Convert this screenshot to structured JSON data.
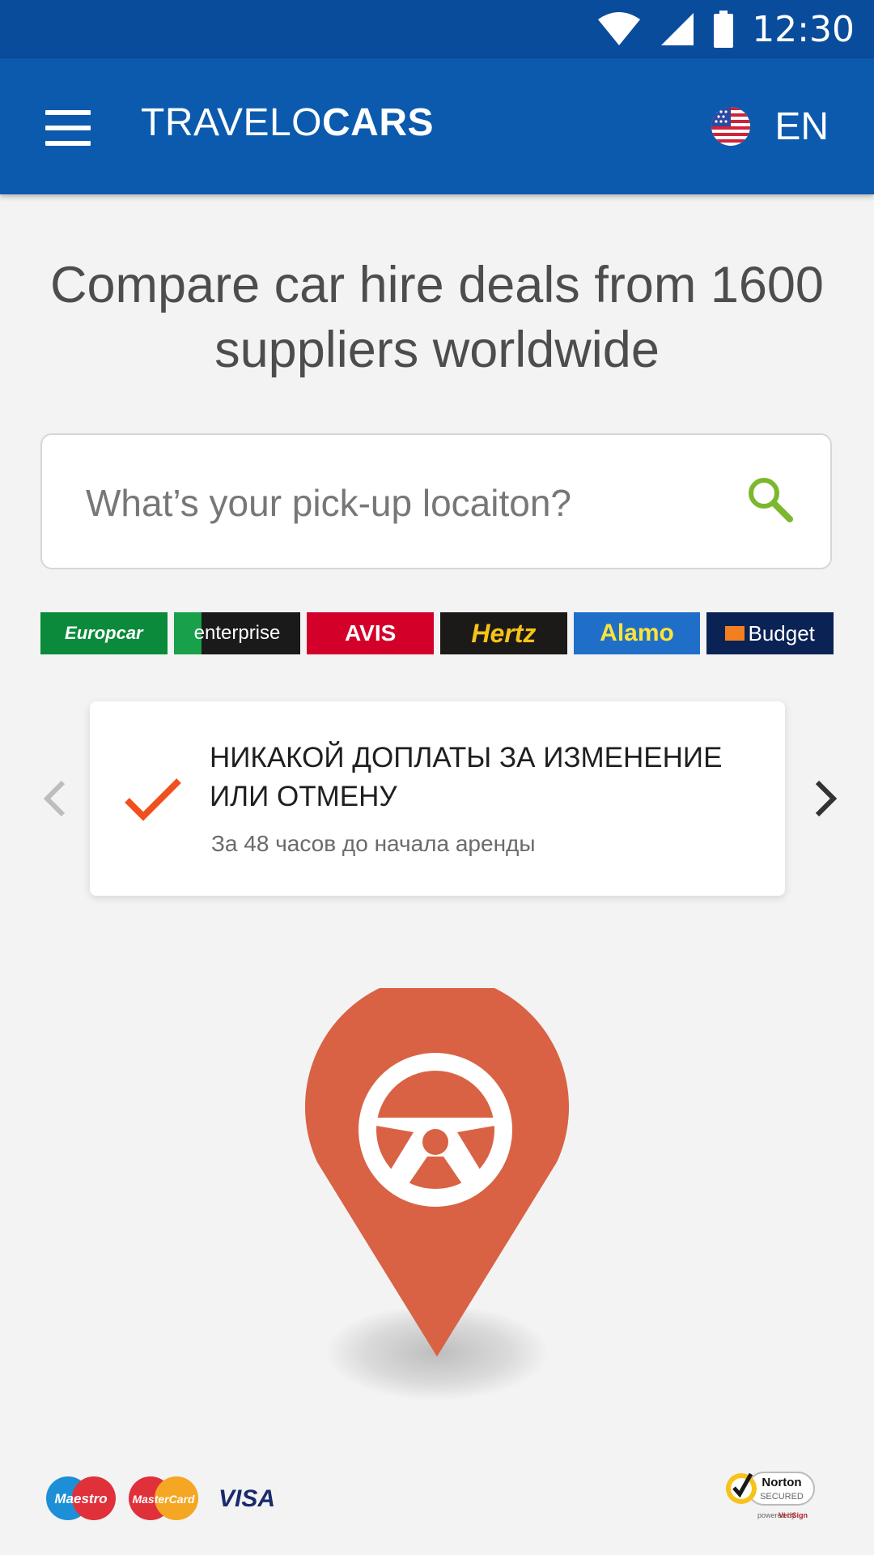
{
  "status_bar": {
    "time": "12:30"
  },
  "app_bar": {
    "brand_light": "TRAVELO",
    "brand_bold": "CARS",
    "language": "EN",
    "flag_icon": "us-flag-icon"
  },
  "headline": "Compare car hire deals from 1600 suppliers worldwide",
  "search": {
    "placeholder": "What’s your pick-up locaiton?",
    "value": "",
    "icon_color": "#7cb82f"
  },
  "suppliers": [
    "Europcar",
    "enterprise",
    "AVIS",
    "Hertz",
    "Alamo",
    "Budget"
  ],
  "feature": {
    "title": "НИКАКОЙ ДОПЛАТЫ ЗА ИЗМЕНЕНИЕ ИЛИ ОТМЕНУ",
    "subtitle": "За 48 часов до начала аренды",
    "check_color": "#f0501e"
  },
  "hero_pin": {
    "icon": "steering-wheel-icon",
    "color": "#d96244"
  },
  "payments": [
    "Maestro",
    "MasterCard",
    "VISA"
  ],
  "trust_badge": {
    "name": "Norton",
    "line2": "SECURED",
    "line3": "powered by",
    "line3_brand": "VeriSign"
  },
  "colors": {
    "primary": "#0b5aae",
    "status_bar": "#0a4c9c",
    "accent": "#d96244"
  }
}
